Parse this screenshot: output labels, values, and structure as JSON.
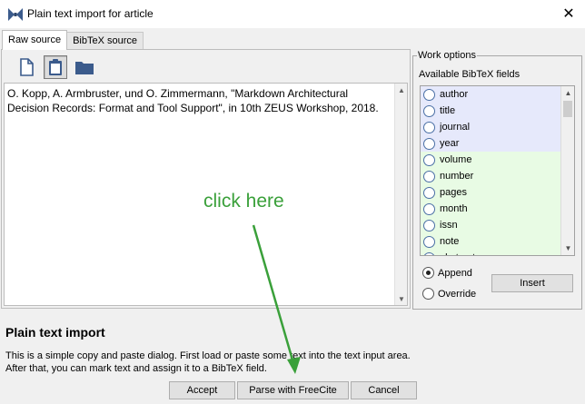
{
  "window": {
    "title": "Plain text import for article",
    "close_glyph": "✕",
    "app_icon": "bow-tie-logo-icon"
  },
  "tabs": [
    {
      "label": "Raw source",
      "active": true
    },
    {
      "label": "BibTeX source",
      "active": false
    }
  ],
  "toolbar": {
    "new_icon": "new-document-icon",
    "paste_icon": "clipboard-icon",
    "open_icon": "folder-icon"
  },
  "source_text": "O. Kopp, A. Armbruster, und O. Zimmermann, \"Markdown Architectural Decision Records: Format and Tool Support\", in 10th ZEUS Workshop, 2018.",
  "work_options": {
    "legend": "Work options",
    "available_label": "Available BibTeX fields",
    "fields": [
      {
        "label": "author",
        "group": "required"
      },
      {
        "label": "title",
        "group": "required"
      },
      {
        "label": "journal",
        "group": "required"
      },
      {
        "label": "year",
        "group": "required"
      },
      {
        "label": "volume",
        "group": "optional"
      },
      {
        "label": "number",
        "group": "optional"
      },
      {
        "label": "pages",
        "group": "optional"
      },
      {
        "label": "month",
        "group": "optional"
      },
      {
        "label": "issn",
        "group": "optional"
      },
      {
        "label": "note",
        "group": "optional"
      },
      {
        "label": "abstract",
        "group": "optional"
      }
    ],
    "append_label": "Append",
    "override_label": "Override",
    "selected_mode": "Append",
    "insert_label": "Insert"
  },
  "info": {
    "title": "Plain text import",
    "line1": "This is a simple copy and paste dialog. First load or paste some text into the text input area.",
    "line2": "After that, you can mark text and assign it to a BibTeX field."
  },
  "buttons": {
    "accept": "Accept",
    "parse": "Parse with FreeCite",
    "cancel": "Cancel"
  },
  "annotation": {
    "text": "click here",
    "color": "#3aa03a"
  },
  "colors": {
    "required_bg": "#e6e9fb",
    "optional_bg": "#e8fbe4",
    "icon_blue": "#3b5b8c"
  }
}
